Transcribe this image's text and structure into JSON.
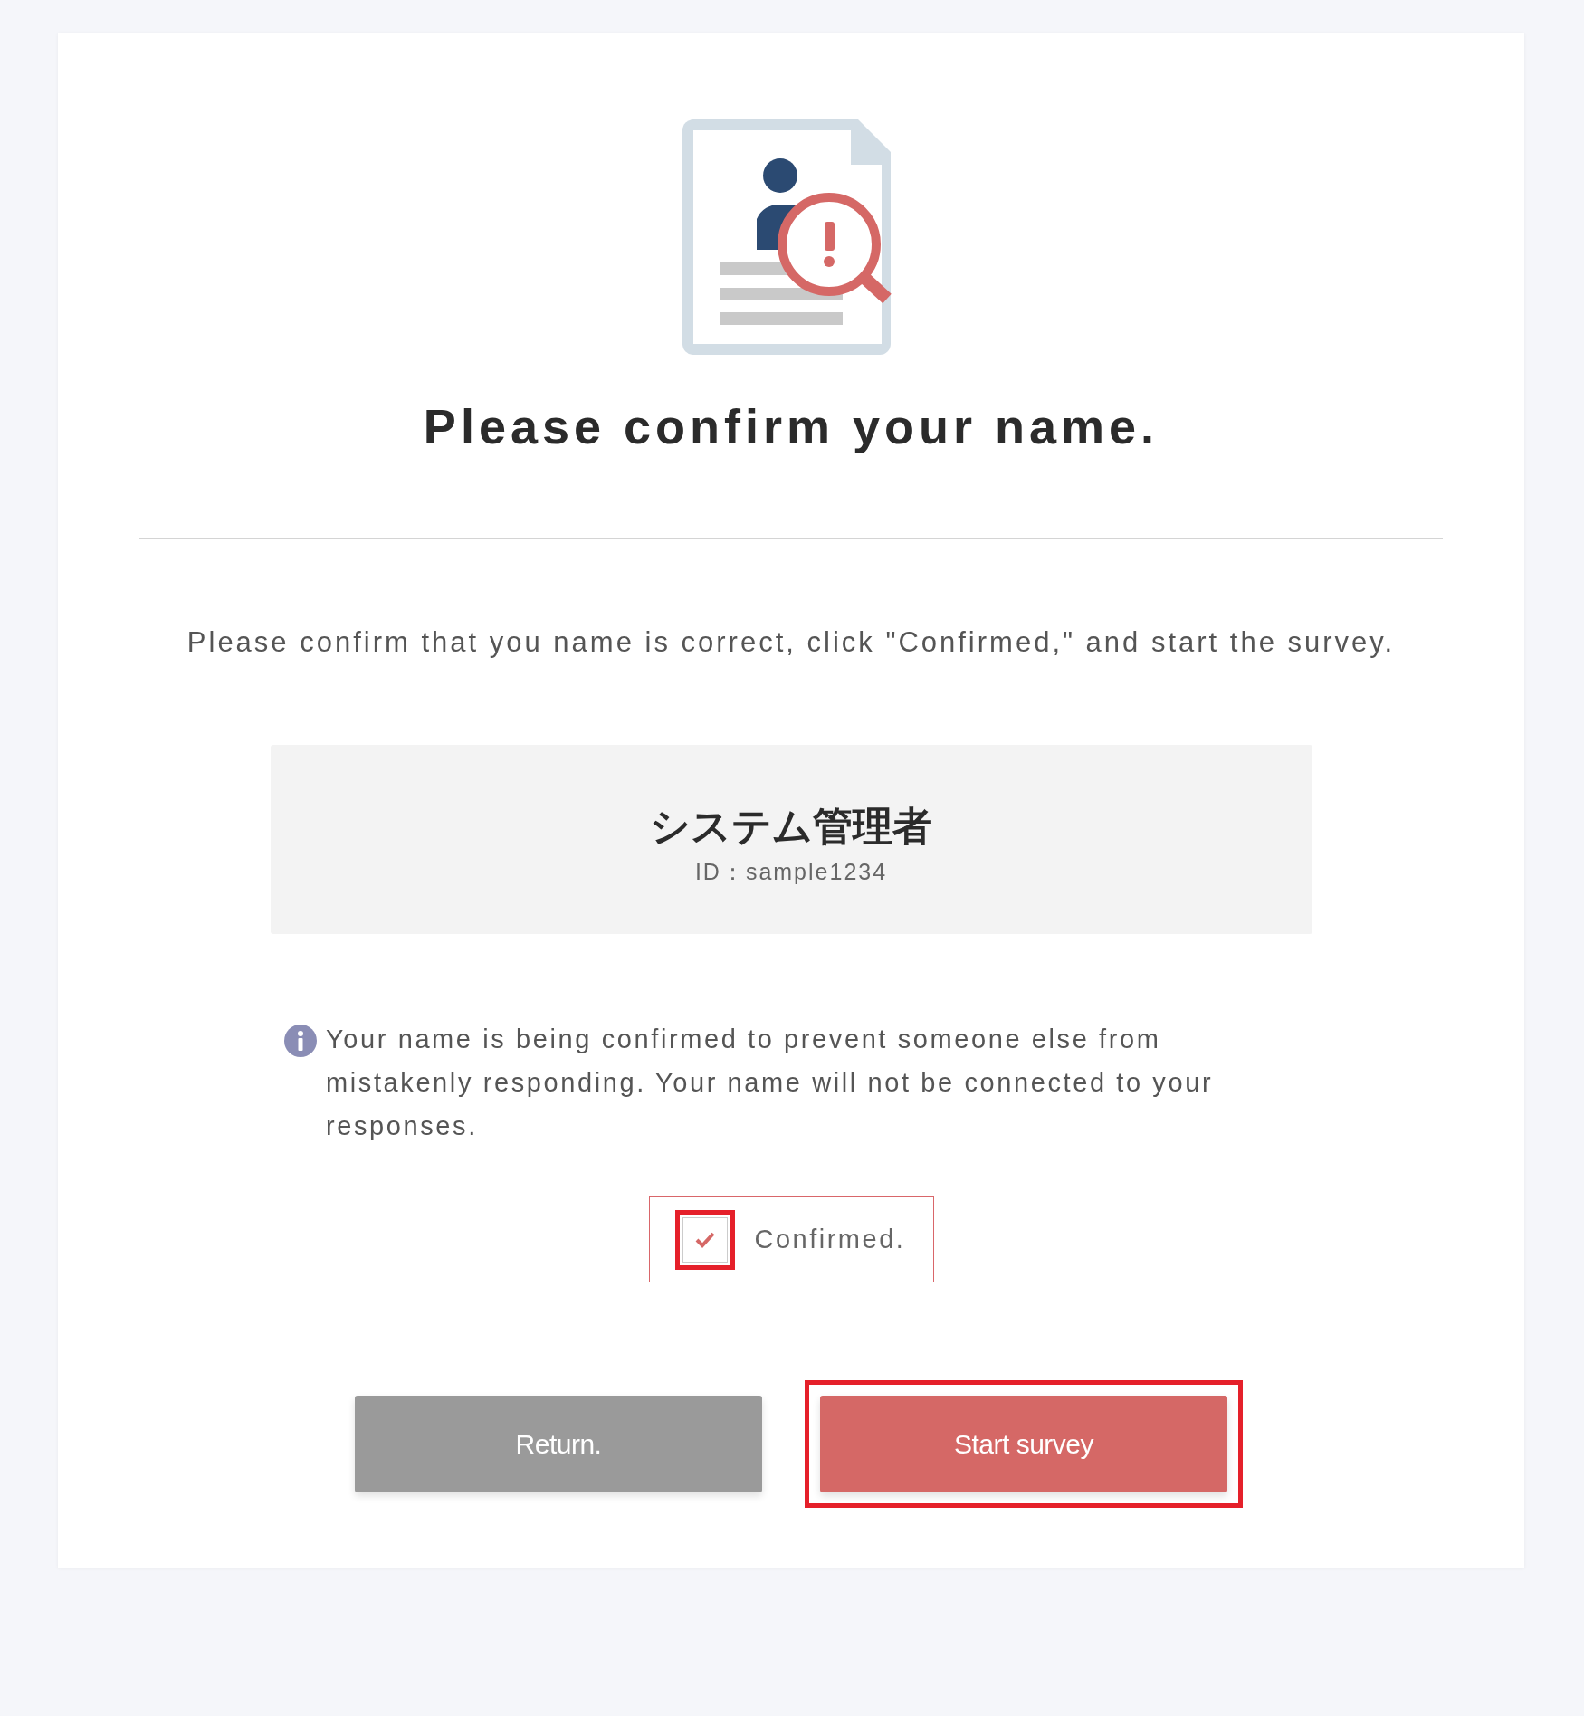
{
  "title": "Please confirm your name.",
  "instructions": "Please confirm that you name is correct, click \"Confirmed,\" and start the survey.",
  "user": {
    "name": "システム管理者",
    "id": "ID：sample1234"
  },
  "notice": "Your name is being confirmed to prevent someone else from mistakenly responding. Your name will not be connected to your responses.",
  "confirm": {
    "label": "Confirmed.",
    "checked": true,
    "highlighted": true
  },
  "buttons": [
    {
      "label": "Return.",
      "kind": "secondary",
      "highlighted": false
    },
    {
      "label": "Start survey",
      "kind": "primary",
      "highlighted": true
    }
  ]
}
